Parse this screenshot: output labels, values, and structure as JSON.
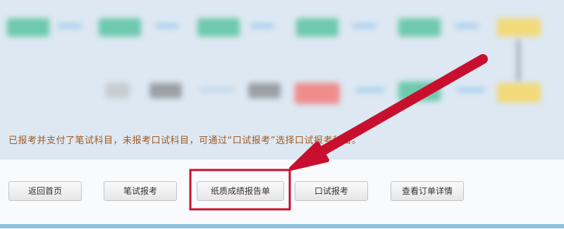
{
  "notice": {
    "text": "已报考并支付了笔试科目，未报考口试科目，可通过“口试报考”选择口试报考科目。"
  },
  "actions": {
    "home": "返回首页",
    "written_exam": "笔试报考",
    "paper_score_report": "纸质成绩报告单",
    "oral_exam": "口试报考",
    "order_details": "查看订单详情"
  },
  "colors": {
    "highlight": "#c8102e",
    "notice_text": "#a05a22",
    "blurred_flow_green": "#6ec9ad",
    "blurred_flow_blue": "#9ecbf0",
    "blurred_flow_yellow": "#f2d97a",
    "blurred_flow_red": "#f08c8c"
  },
  "annotation": {
    "arrow_icon": "red-arrow-icon",
    "highlight_icon": "red-rectangle-highlight"
  }
}
